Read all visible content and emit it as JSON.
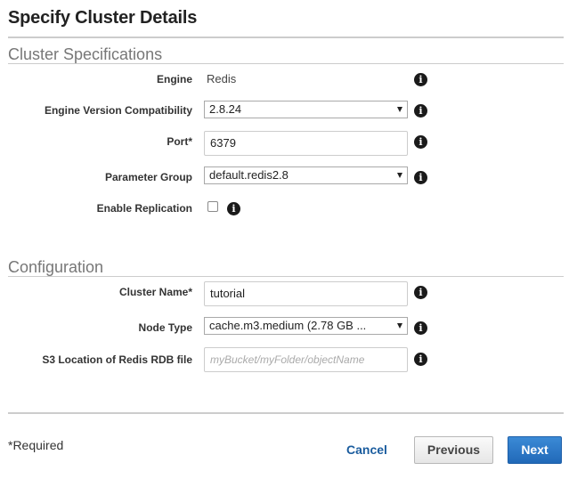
{
  "page": {
    "title": "Specify Cluster Details"
  },
  "cluster_specifications": {
    "section_title": "Cluster Specifications",
    "engine": {
      "label": "Engine",
      "value": "Redis"
    },
    "engine_version": {
      "label": "Engine Version Compatibility",
      "value": "2.8.24"
    },
    "port": {
      "label": "Port*",
      "value": "6379"
    },
    "parameter_group": {
      "label": "Parameter Group",
      "value": "default.redis2.8"
    },
    "enable_replication": {
      "label": "Enable Replication",
      "checked": false
    }
  },
  "configuration": {
    "section_title": "Configuration",
    "cluster_name": {
      "label": "Cluster Name*",
      "value": "tutorial"
    },
    "node_type": {
      "label": "Node Type",
      "value": "cache.m3.medium (2.78 GB ..."
    },
    "s3_location": {
      "label": "S3 Location of Redis RDB file",
      "value": "",
      "placeholder": "myBucket/myFolder/objectName"
    }
  },
  "footer": {
    "required_note": "*Required",
    "cancel_label": "Cancel",
    "previous_label": "Previous",
    "next_label": "Next"
  },
  "icons": {
    "info": "info-icon",
    "dropdown": "chevron-down-icon"
  },
  "colors": {
    "primary_button": "#2a74c4",
    "link": "#1a5c9e",
    "section_title": "#777777"
  }
}
